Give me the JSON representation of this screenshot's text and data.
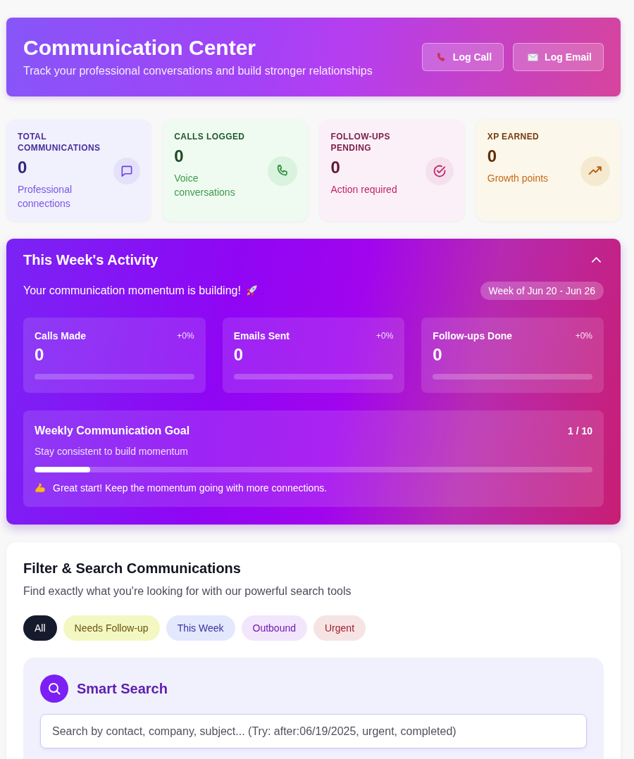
{
  "header": {
    "title": "Communication Center",
    "subtitle": "Track your professional conversations and build stronger relationships",
    "actions": [
      {
        "label": "Log Call",
        "kind": "call"
      },
      {
        "label": "Log Email",
        "kind": "email"
      }
    ]
  },
  "stats": [
    {
      "kind": "messages",
      "label": "TOTAL COMMUNICATIONS",
      "value": "0",
      "caption": "Professional connections"
    },
    {
      "kind": "calls",
      "label": "CALLS LOGGED",
      "value": "0",
      "caption": "Voice conversations"
    },
    {
      "kind": "followups",
      "label": "FOLLOW-UPS PENDING",
      "value": "0",
      "caption": "Action required"
    },
    {
      "kind": "xp",
      "label": "XP EARNED",
      "value": "0",
      "caption": "Growth points"
    }
  ],
  "activity": {
    "title": "This Week's Activity",
    "expanded": true,
    "message": "Your communication momentum is building!",
    "week": "Week of Jun 20 - Jun 26",
    "metrics": [
      {
        "label": "Calls Made",
        "change": "+0%",
        "value": "0"
      },
      {
        "label": "Emails Sent",
        "change": "+0%",
        "value": "0"
      },
      {
        "label": "Follow-ups Done",
        "change": "+0%",
        "value": "0"
      }
    ],
    "goal": {
      "title": "Weekly Communication Goal",
      "progress": "1 / 10",
      "subtitle": "Stay consistent to build momentum",
      "level": 0.1,
      "note": "Great start! Keep the momentum going with more connections."
    }
  },
  "filters": {
    "title": "Filter & Search Communications",
    "subtitle": "Find exactly what you're looking for with our powerful search tools",
    "options": [
      {
        "label": "All",
        "kind": "all",
        "selected": true
      },
      {
        "label": "Needs Follow-up",
        "kind": "follow-up",
        "selected": false
      },
      {
        "label": "This Week",
        "kind": "week",
        "selected": false
      },
      {
        "label": "Outbound",
        "kind": "outbound",
        "selected": false
      },
      {
        "label": "Urgent",
        "kind": "urgent",
        "selected": false
      }
    ]
  },
  "smart_search": {
    "title": "Smart Search",
    "placeholder": "Search by contact, company, subject... (Try: after:06/19/2025, urgent, completed)"
  }
}
